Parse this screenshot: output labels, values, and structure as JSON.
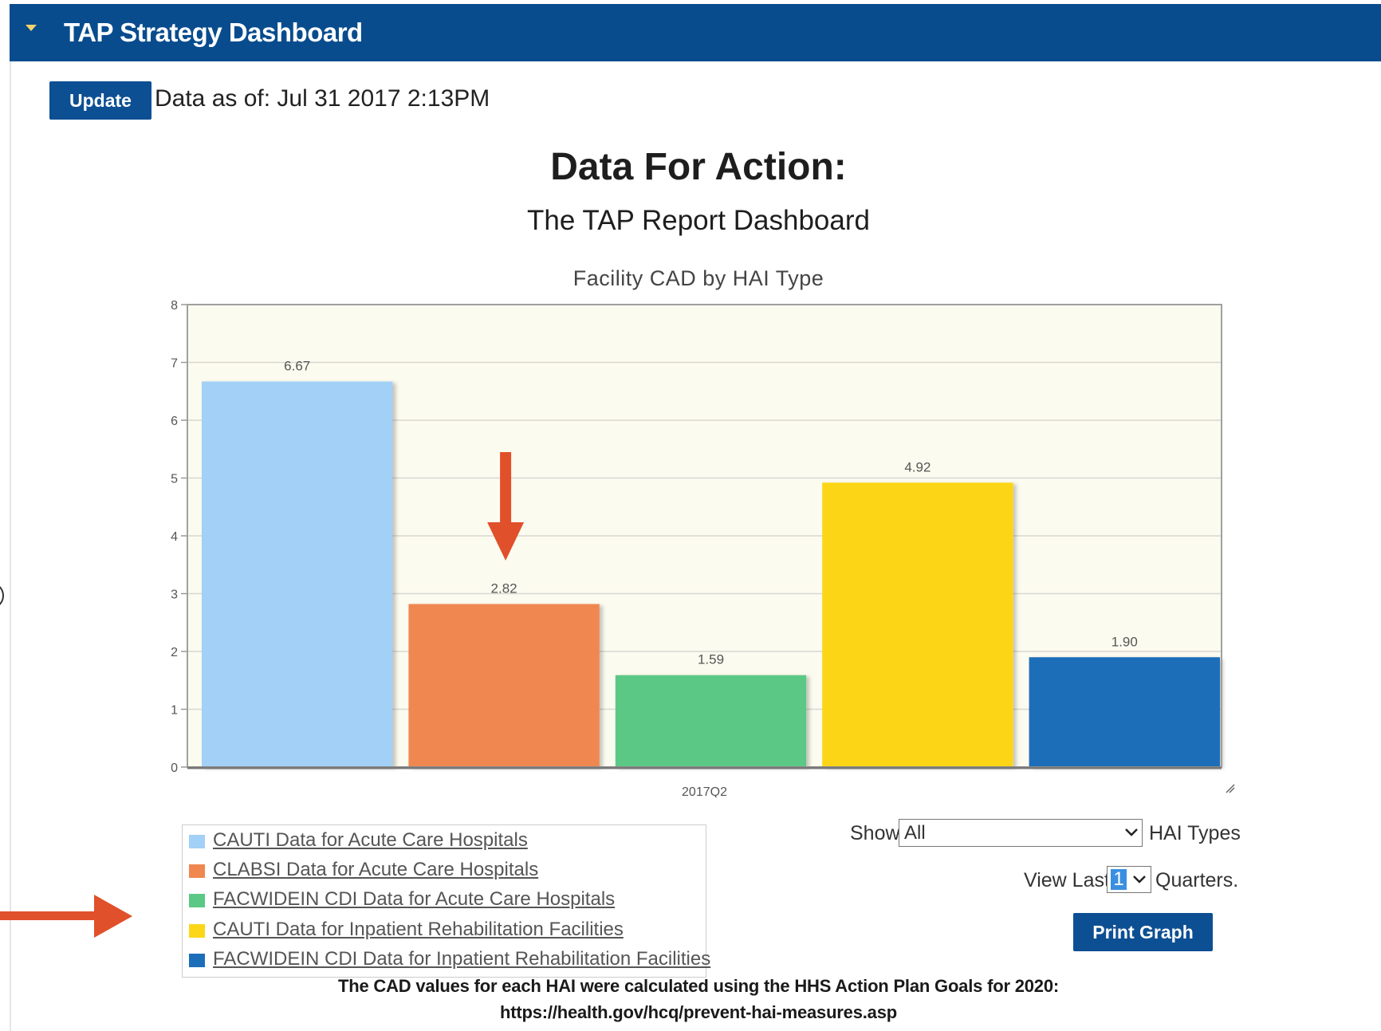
{
  "header": {
    "title": "TAP Strategy Dashboard"
  },
  "toolbar": {
    "update_label": "Update",
    "data_as_of": "Data as of: Jul 31 2017 2:13PM"
  },
  "page": {
    "title": "Data For Action:",
    "subtitle": "The TAP Report Dashboard"
  },
  "chart_data": {
    "type": "bar",
    "title": "Facility CAD by HAI Type",
    "categories": [
      "2017Q2"
    ],
    "xlabel": "",
    "ylabel": "",
    "ylim": [
      0,
      8
    ],
    "yticks": [
      "0",
      "1",
      "2",
      "3",
      "4",
      "5",
      "6",
      "7",
      "8"
    ],
    "grid": true,
    "legend_position": "bottom-left",
    "series": [
      {
        "name": "CAUTI Data for Acute Care Hospitals",
        "values": [
          6.67
        ],
        "label": "6.67",
        "color": "#a2d0f6"
      },
      {
        "name": "CLABSI Data for Acute Care Hospitals",
        "values": [
          2.82
        ],
        "label": "2.82",
        "color": "#f08751"
      },
      {
        "name": "FACWIDEIN CDI Data for Acute Care Hospitals",
        "values": [
          1.59
        ],
        "label": "1.59",
        "color": "#5cc885"
      },
      {
        "name": "CAUTI Data for Inpatient Rehabilitation Facilities",
        "values": [
          4.92
        ],
        "label": "4.92",
        "color": "#fcd619"
      },
      {
        "name": "FACWIDEIN CDI Data for Inpatient Rehabilitation Facilities",
        "values": [
          1.9
        ],
        "label": "1.90",
        "color": "#1c6eb9"
      }
    ],
    "plot_background": "#fcfbef",
    "annotation_arrow_color": "#e0502a"
  },
  "controls": {
    "show_prefix": "Show",
    "show_value": "All",
    "show_suffix": "HAI Types",
    "view_prefix": "View Last",
    "view_value": "1",
    "view_suffix": "Quarters.",
    "print_label": "Print Graph"
  },
  "footnote": {
    "text": "The CAD values for each HAI were calculated using the HHS Action Plan Goals for 2020:",
    "url": "https://health.gov/hcq/prevent-hai-measures.asp"
  },
  "icons": {
    "collapse": "caret-down-icon",
    "dropdown": "chevron-down-icon",
    "resize": "resize-grip-icon",
    "annotation": "arrow-icon"
  }
}
